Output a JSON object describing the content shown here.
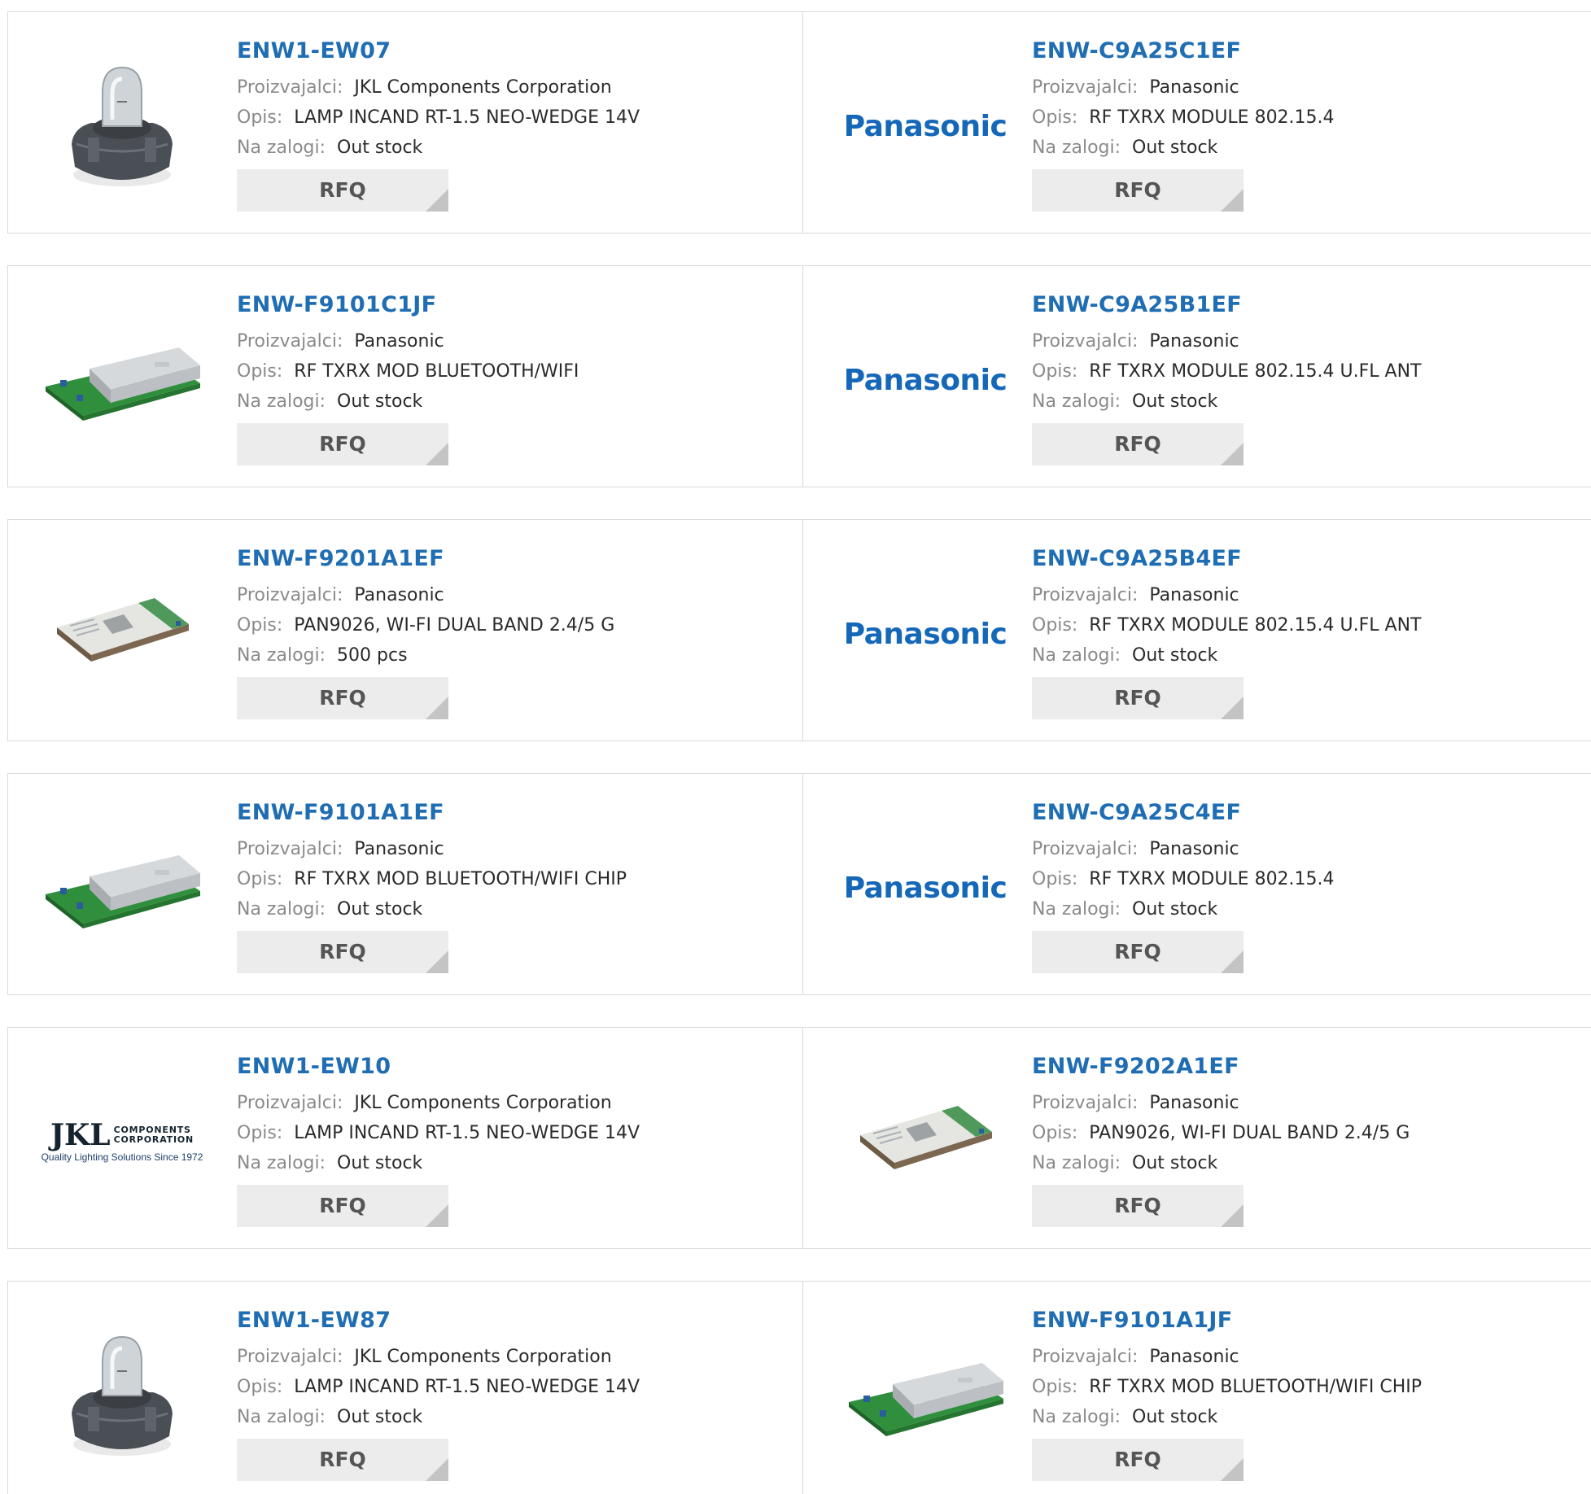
{
  "labels": {
    "manufacturer": "Proizvajalci:",
    "description": "Opis:",
    "stock": "Na zalogi:",
    "rfq": "RFQ"
  },
  "logos": {
    "panasonic": "Panasonic",
    "jkl_big": "JKL",
    "jkl_small_1": "COMPONENTS",
    "jkl_small_2": "CORPORATION",
    "jkl_tagline": "Quality Lighting Solutions Since 1972"
  },
  "products": [
    {
      "part": "ENW1-EW07",
      "manufacturer": "JKL Components Corporation",
      "description": "LAMP INCAND RT-1.5 NEO-WEDGE 14V",
      "stock": "Out stock",
      "image": "lamp-image"
    },
    {
      "part": "ENW-C9A25C1EF",
      "manufacturer": "Panasonic",
      "description": "RF TXRX MODULE 802.15.4",
      "stock": "Out stock",
      "image": "panasonic-logo"
    },
    {
      "part": "ENW-F9101C1JF",
      "manufacturer": "Panasonic",
      "description": "RF TXRX MOD BLUETOOTH/WIFI",
      "stock": "Out stock",
      "image": "module-image"
    },
    {
      "part": "ENW-C9A25B1EF",
      "manufacturer": "Panasonic",
      "description": "RF TXRX MODULE 802.15.4 U.FL ANT",
      "stock": "Out stock",
      "image": "panasonic-logo"
    },
    {
      "part": "ENW-F9201A1EF",
      "manufacturer": "Panasonic",
      "description": "PAN9026, WI-FI DUAL BAND 2.4/5 G",
      "stock": "500 pcs",
      "image": "wifi-chip-image"
    },
    {
      "part": "ENW-C9A25B4EF",
      "manufacturer": "Panasonic",
      "description": "RF TXRX MODULE 802.15.4 U.FL ANT",
      "stock": "Out stock",
      "image": "panasonic-logo"
    },
    {
      "part": "ENW-F9101A1EF",
      "manufacturer": "Panasonic",
      "description": "RF TXRX MOD BLUETOOTH/WIFI CHIP",
      "stock": "Out stock",
      "image": "module-image"
    },
    {
      "part": "ENW-C9A25C4EF",
      "manufacturer": "Panasonic",
      "description": "RF TXRX MODULE 802.15.4",
      "stock": "Out stock",
      "image": "panasonic-logo"
    },
    {
      "part": "ENW1-EW10",
      "manufacturer": "JKL Components Corporation",
      "description": "LAMP INCAND RT-1.5 NEO-WEDGE 14V",
      "stock": "Out stock",
      "image": "jkl-logo"
    },
    {
      "part": "ENW-F9202A1EF",
      "manufacturer": "Panasonic",
      "description": "PAN9026, WI-FI DUAL BAND 2.4/5 G",
      "stock": "Out stock",
      "image": "wifi-chip-image"
    },
    {
      "part": "ENW1-EW87",
      "manufacturer": "JKL Components Corporation",
      "description": "LAMP INCAND RT-1.5 NEO-WEDGE 14V",
      "stock": "Out stock",
      "image": "lamp-image"
    },
    {
      "part": "ENW-F9101A1JF",
      "manufacturer": "Panasonic",
      "description": "RF TXRX MOD BLUETOOTH/WIFI CHIP",
      "stock": "Out stock",
      "image": "module-image"
    }
  ]
}
